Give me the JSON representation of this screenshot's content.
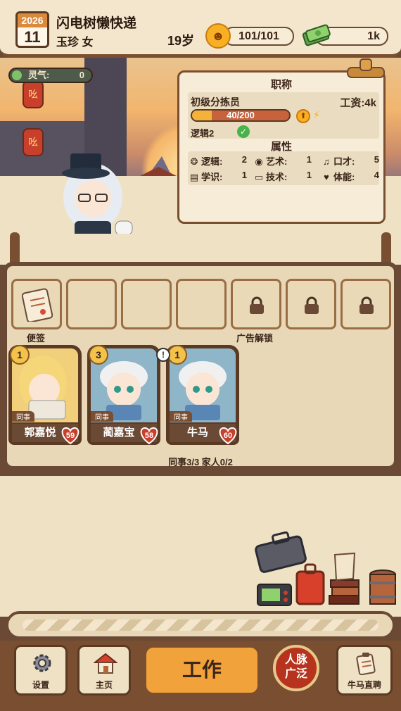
{
  "header": {
    "year": "2026",
    "day": "11",
    "company": "闪电树懒快递",
    "player_name_gender": "玉珍 女",
    "age": "19岁",
    "mood": "101/101",
    "money": "1k",
    "mood_icon": "smiley-face-icon",
    "money_icon": "cash-stack-icon"
  },
  "scene": {
    "qi_label": "灵气:",
    "qi_value": "0",
    "lantern_text": "吆"
  },
  "job_card": {
    "title_header": "职称",
    "job_title": "初级分拣员",
    "salary": "工资:4k",
    "xp_text": "40/200",
    "xp_fraction": 0.2,
    "requirement": "逻辑2",
    "attributes_header": "属性",
    "attributes": [
      {
        "label": "逻辑:",
        "value": "2",
        "icon": "brain-icon"
      },
      {
        "label": "艺术:",
        "value": "1",
        "icon": "lips-icon"
      },
      {
        "label": "口才:",
        "value": "5",
        "icon": "music-note-icon"
      },
      {
        "label": "学识:",
        "value": "1",
        "icon": "book-icon"
      },
      {
        "label": "技术:",
        "value": "1",
        "icon": "monitor-icon"
      },
      {
        "label": "体能:",
        "value": "4",
        "icon": "heart-shield-icon"
      }
    ]
  },
  "slots": {
    "label_note": "便签",
    "label_ad_unlock": "广告解锁"
  },
  "colleagues": [
    {
      "name": "郭嘉悦",
      "level": "1",
      "tag": "同事",
      "hp": "59"
    },
    {
      "name": "蔺嘉宝",
      "level": "3",
      "tag": "同事",
      "hp": "58"
    },
    {
      "name": "牛马",
      "level": "1",
      "tag": "同事",
      "hp": "60"
    }
  ],
  "counts": "同事3/3 家人0/2",
  "bottom_nav": {
    "settings": "设置",
    "home": "主页",
    "work": "工作",
    "network_line1": "人脉",
    "network_line2": "广泛",
    "recruit": "牛马直聘"
  }
}
